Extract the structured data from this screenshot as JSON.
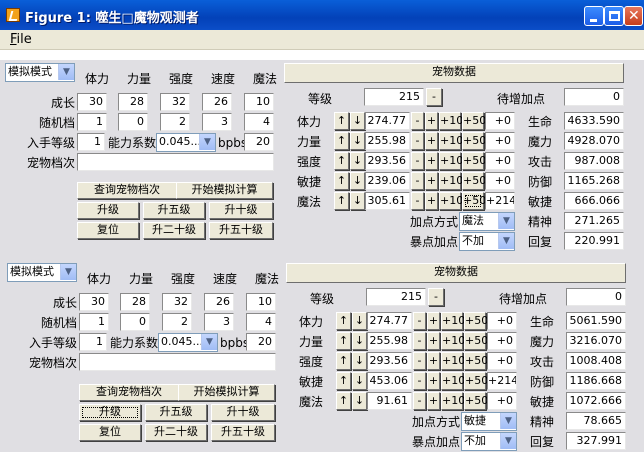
{
  "window": {
    "title": "Figure 1: 噬生□魔物观测者",
    "menu_file": "File"
  },
  "panels": [
    {
      "mode_select": "模拟模式",
      "stat_headers": [
        "体力",
        "力量",
        "强度",
        "速度",
        "魔法"
      ],
      "growth_label": "成长",
      "growth": [
        "30",
        "28",
        "32",
        "26",
        "10"
      ],
      "random_label": "随机档",
      "random": [
        "1",
        "0",
        "2",
        "3",
        "4"
      ],
      "join_level_label": "入手等级",
      "join_level": "1",
      "ability_coef_label": "能力系数",
      "ability_coef": "0.045...",
      "bpbs_label": "bpbs",
      "bpbs": "20",
      "pet_file_label": "宠物档次",
      "pet_file": "",
      "buttons": {
        "query": "查询宠物档次",
        "start": "开始模拟计算",
        "lvl1": "升级",
        "lvl5": "升五级",
        "lvl10": "升十级",
        "reset": "复位",
        "lvl20": "升二十级",
        "lvl50": "升五十级"
      },
      "pet_data_header": "宠物数据",
      "level_label": "等级",
      "level": "215",
      "pending_label": "待增加点",
      "pending": "0",
      "attrs": [
        {
          "label": "体力",
          "value": "274.77",
          "bonus": "+0"
        },
        {
          "label": "力量",
          "value": "255.98",
          "bonus": "+0"
        },
        {
          "label": "强度",
          "value": "293.56",
          "bonus": "+0"
        },
        {
          "label": "敏捷",
          "value": "239.06",
          "bonus": "+0"
        },
        {
          "label": "魔法",
          "value": "305.61",
          "bonus": "+214"
        }
      ],
      "derived": [
        {
          "label": "生命",
          "value": "4633.590"
        },
        {
          "label": "魔力",
          "value": "4928.070"
        },
        {
          "label": "攻击",
          "value": "987.008"
        },
        {
          "label": "防御",
          "value": "1165.268"
        },
        {
          "label": "敏捷",
          "value": "666.066"
        },
        {
          "label": "精神",
          "value": "271.265"
        },
        {
          "label": "回复",
          "value": "220.991"
        }
      ],
      "addpoint_mode_label": "加点方式",
      "addpoint_mode": "魔法",
      "burst_label": "暴点加点",
      "burst": "不加"
    },
    {
      "mode_select": "模拟模式",
      "stat_headers": [
        "体力",
        "力量",
        "强度",
        "速度",
        "魔法"
      ],
      "growth_label": "成长",
      "growth": [
        "30",
        "28",
        "32",
        "26",
        "10"
      ],
      "random_label": "随机档",
      "random": [
        "1",
        "0",
        "2",
        "3",
        "4"
      ],
      "join_level_label": "入手等级",
      "join_level": "1",
      "ability_coef_label": "能力系数",
      "ability_coef": "0.045...",
      "bpbs_label": "bpbs",
      "bpbs": "20",
      "pet_file_label": "宠物档次",
      "pet_file": "",
      "buttons": {
        "query": "查询宠物档次",
        "start": "开始模拟计算",
        "lvl1": "升级",
        "lvl5": "升五级",
        "lvl10": "升十级",
        "reset": "复位",
        "lvl20": "升二十级",
        "lvl50": "升五十级"
      },
      "pet_data_header": "宠物数据",
      "level_label": "等级",
      "level": "215",
      "pending_label": "待增加点",
      "pending": "0",
      "attrs": [
        {
          "label": "体力",
          "value": "274.77",
          "bonus": "+0"
        },
        {
          "label": "力量",
          "value": "255.98",
          "bonus": "+0"
        },
        {
          "label": "强度",
          "value": "293.56",
          "bonus": "+0"
        },
        {
          "label": "敏捷",
          "value": "453.06",
          "bonus": "+214"
        },
        {
          "label": "魔法",
          "value": "91.61",
          "bonus": "+0"
        }
      ],
      "derived": [
        {
          "label": "生命",
          "value": "5061.590"
        },
        {
          "label": "魔力",
          "value": "3216.070"
        },
        {
          "label": "攻击",
          "value": "1008.408"
        },
        {
          "label": "防御",
          "value": "1186.668"
        },
        {
          "label": "敏捷",
          "value": "1072.666"
        },
        {
          "label": "精神",
          "value": "78.665"
        },
        {
          "label": "回复",
          "value": "327.991"
        }
      ],
      "addpoint_mode_label": "加点方式",
      "addpoint_mode": "敏捷",
      "burst_label": "暴点加点",
      "burst": "不加"
    }
  ],
  "step_buttons": {
    "up": "↑",
    "down": "↓",
    "minus": "-",
    "plus": "+",
    "plus10": "+10",
    "plus50": "+50"
  }
}
